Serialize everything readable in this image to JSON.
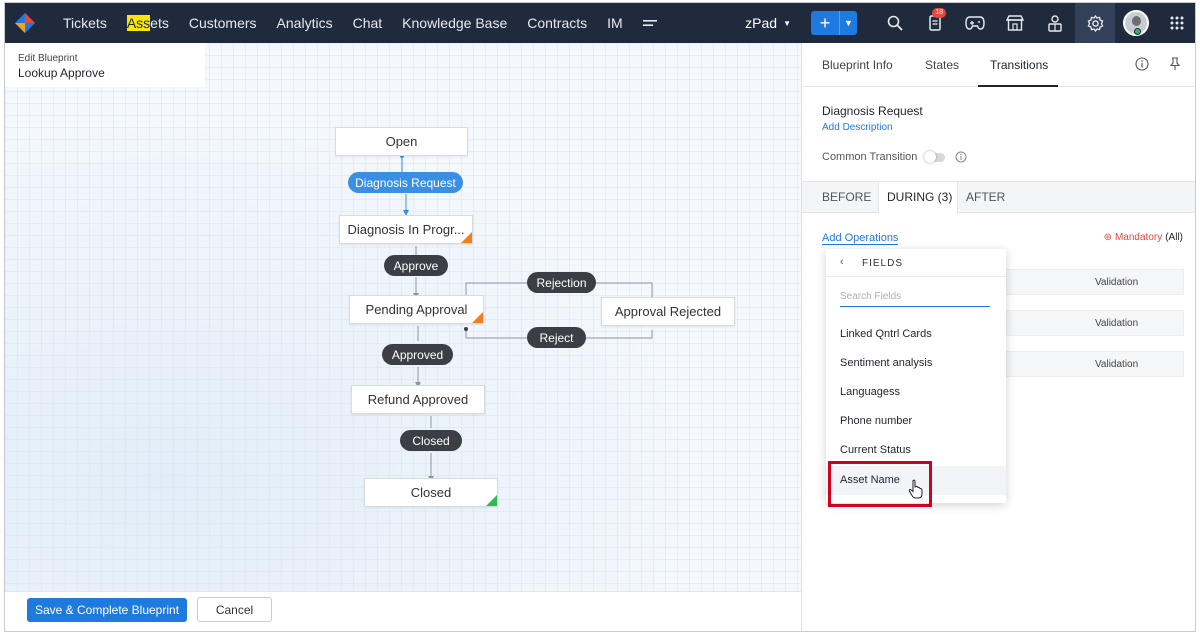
{
  "nav": {
    "items": [
      "Tickets",
      "Customers",
      "Analytics",
      "Chat",
      "Knowledge Base",
      "Contracts",
      "IM"
    ],
    "assets_highlight": "Ass",
    "assets_rest": "ets",
    "zpad": "zPad",
    "notification_count": "18"
  },
  "blueprint": {
    "sub_label": "Edit Blueprint",
    "name": "Lookup Approve"
  },
  "flow": {
    "nodes": [
      "Open",
      "Diagnosis In Progr...",
      "Pending Approval",
      "Approval Rejected",
      "Refund Approved",
      "Closed"
    ],
    "transitions": [
      "Diagnosis Request",
      "Approve",
      "Rejection",
      "Reject",
      "Approved",
      "Closed"
    ]
  },
  "footer": {
    "save_label": "Save & Complete Blueprint",
    "cancel_label": "Cancel"
  },
  "panel": {
    "tabs": [
      "Blueprint Info",
      "States",
      "Transitions"
    ],
    "active_tab": "Transitions",
    "transition_name": "Diagnosis Request",
    "add_description": "Add Description",
    "common_transition": "Common Transition",
    "phases": [
      "BEFORE",
      "DURING (3)",
      "AFTER"
    ],
    "active_phase": "DURING (3)",
    "add_operations": "Add Operations",
    "mandatory": "Mandatory",
    "mandatory_scope": "(All)",
    "validation_label": "Validation",
    "dropdown": {
      "header": "FIELDS",
      "search_placeholder": "Search Fields",
      "items": [
        "Linked Qntrl Cards",
        "Sentiment analysis",
        "Languagess",
        "Phone number",
        "Current Status",
        "Asset Name"
      ],
      "hovered": "Asset Name"
    }
  },
  "colors": {
    "topbar": "#1f2a3c",
    "accent": "#1f7ae0",
    "pill_dark": "#3b3f45",
    "pill_blue": "#3a8fe4",
    "status_orange": "#f0801e",
    "status_green": "#2dbb4e",
    "highlight_box": "#d0021b"
  }
}
